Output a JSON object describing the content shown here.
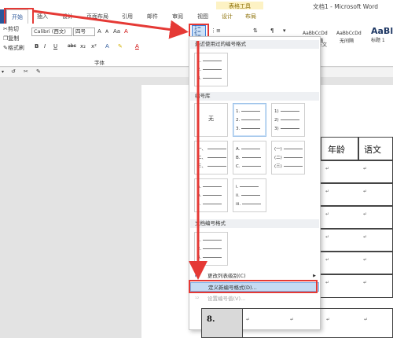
{
  "window": {
    "title": "文档1 - Microsoft Word",
    "context_group": "表格工具"
  },
  "ribbon_tabs": [
    "开始",
    "插入",
    "设计",
    "页面布局",
    "引用",
    "邮件",
    "审阅",
    "视图",
    "设计",
    "布局"
  ],
  "clipboard": {
    "cut": "剪切",
    "copy": "复制",
    "painter": "格式刷"
  },
  "font": {
    "name": "Calibri (西文)",
    "size": "四号",
    "group_label": "字体",
    "size_up": "A",
    "size_down": "A",
    "case": "Aa",
    "clear": "A"
  },
  "format_buttons": [
    "B",
    "I",
    "U",
    "abc",
    "x₂",
    "x²"
  ],
  "styles": [
    {
      "sample": "AaBbCcDd",
      "name": "无间隔"
    },
    {
      "sample": "AaBbCcDd",
      "name": "无间隔"
    },
    {
      "sample": "AaBl",
      "name": "标题 1"
    }
  ],
  "styles_partial": "正文",
  "numbering_menu": {
    "recent_header": "最近使用过的编号格式",
    "recent": [
      "1.",
      "2.",
      "3."
    ],
    "library_header": "编号库",
    "library": [
      {
        "none_label": "无"
      },
      {
        "lines": [
          "1.",
          "2.",
          "3."
        ],
        "selected": true
      },
      {
        "lines": [
          "1)",
          "2)",
          "3)"
        ]
      },
      {
        "lines": [
          "一、",
          "二、",
          "三、"
        ]
      },
      {
        "lines": [
          "A.",
          "B.",
          "C."
        ]
      },
      {
        "lines": [
          "(一)",
          "(二)",
          "(三)"
        ]
      },
      {
        "lines": [
          "a.",
          "b.",
          "c."
        ]
      },
      {
        "lines": [
          "i.",
          "ii.",
          "iii."
        ]
      }
    ],
    "doc_header": "文档编号格式",
    "doc_formats": [
      "1.",
      "2.",
      "3."
    ],
    "items": [
      {
        "label": "更改列表级别(C)",
        "submenu": true
      },
      {
        "label": "定义新编号格式(D)...",
        "highlighted": true
      },
      {
        "label": "设置编号值(V)...",
        "disabled": true
      }
    ]
  },
  "table": {
    "headers": [
      "年龄",
      "语文"
    ],
    "row_label": "8.",
    "mark": "↵"
  },
  "colors": {
    "accent": "#2b579a",
    "annotation": "#e53935"
  }
}
